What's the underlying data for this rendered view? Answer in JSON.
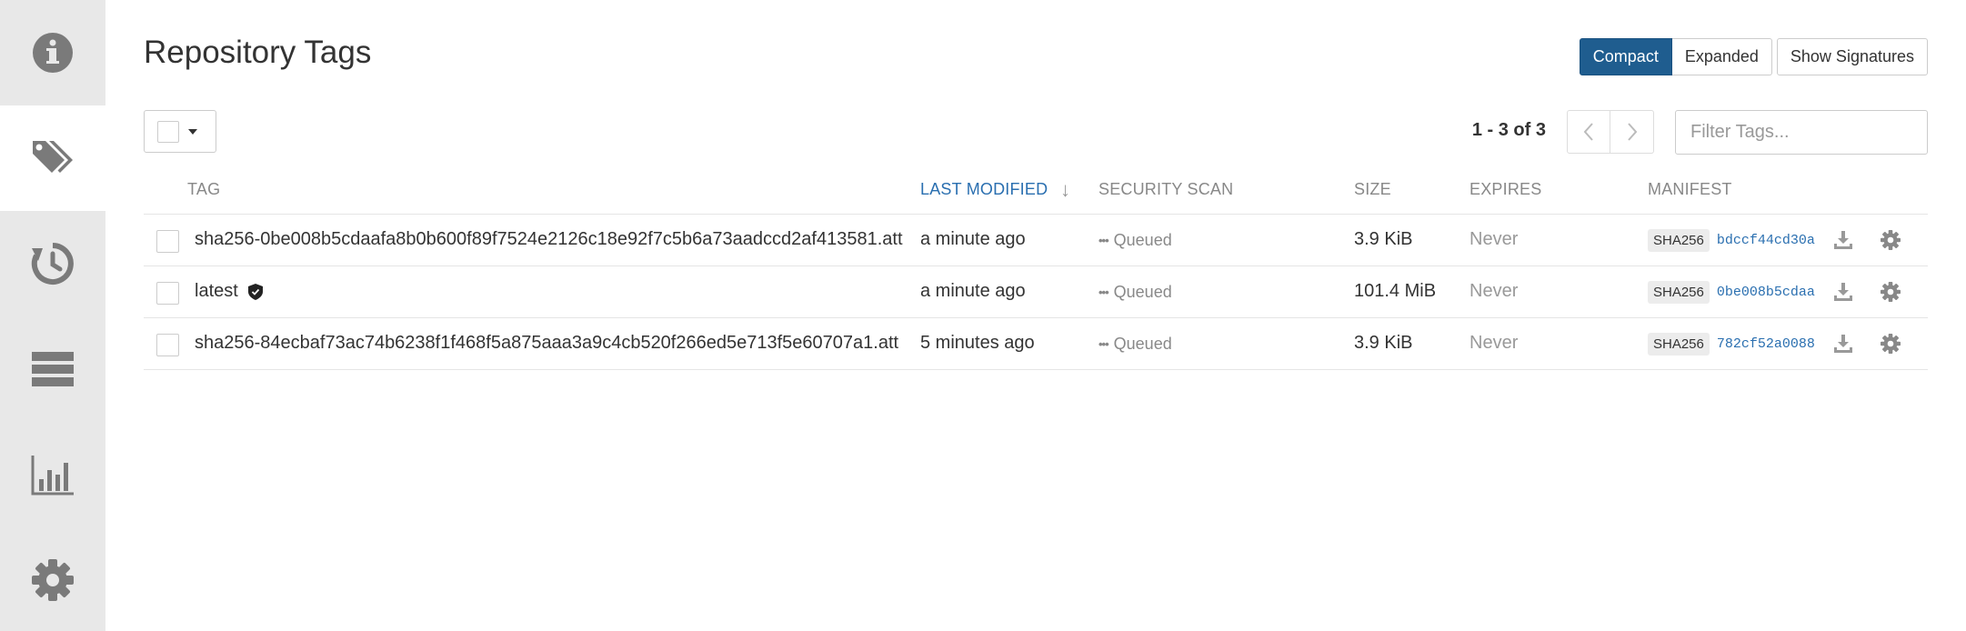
{
  "page": {
    "title": "Repository Tags"
  },
  "sidebar": {
    "items": [
      {
        "name": "info",
        "icon": "info-icon"
      },
      {
        "name": "tags",
        "icon": "tags-icon",
        "active": true
      },
      {
        "name": "history",
        "icon": "history-icon"
      },
      {
        "name": "builds",
        "icon": "builds-icon"
      },
      {
        "name": "usage-logs",
        "icon": "bar-chart-icon"
      },
      {
        "name": "settings",
        "icon": "gear-icon"
      }
    ]
  },
  "toolbar": {
    "compact_label": "Compact",
    "expanded_label": "Expanded",
    "signatures_label": "Show Signatures",
    "paging_text": "1 - 3 of 3",
    "filter_placeholder": "Filter Tags..."
  },
  "table": {
    "headers": {
      "tag": "TAG",
      "last_modified": "LAST MODIFIED",
      "security_scan": "SECURITY SCAN",
      "size": "SIZE",
      "expires": "EXPIRES",
      "manifest": "MANIFEST"
    },
    "rows": [
      {
        "tag": "sha256-0be008b5cdaafa8b0b600f89f7524e2126c18e92f7c5b6a73aadccd2af413581.att",
        "signed": false,
        "last_modified": "a minute ago",
        "scan": "Queued",
        "size": "3.9 KiB",
        "expires": "Never",
        "digest_algo": "SHA256",
        "digest": "bdccf44cd30a"
      },
      {
        "tag": "latest",
        "signed": true,
        "last_modified": "a minute ago",
        "scan": "Queued",
        "size": "101.4 MiB",
        "expires": "Never",
        "digest_algo": "SHA256",
        "digest": "0be008b5cdaa"
      },
      {
        "tag": "sha256-84ecbaf73ac74b6238f1f468f5a875aaa3a9c4cb520f266ed5e713f5e60707a1.att",
        "signed": false,
        "last_modified": "5 minutes ago",
        "scan": "Queued",
        "size": "3.9 KiB",
        "expires": "Never",
        "digest_algo": "SHA256",
        "digest": "782cf52a0088"
      }
    ]
  },
  "colors": {
    "sidebar_bg": "#e8e8e8",
    "icon": "#7a7a7a",
    "primary": "#1f5d8f",
    "link": "#2a6fb0"
  }
}
